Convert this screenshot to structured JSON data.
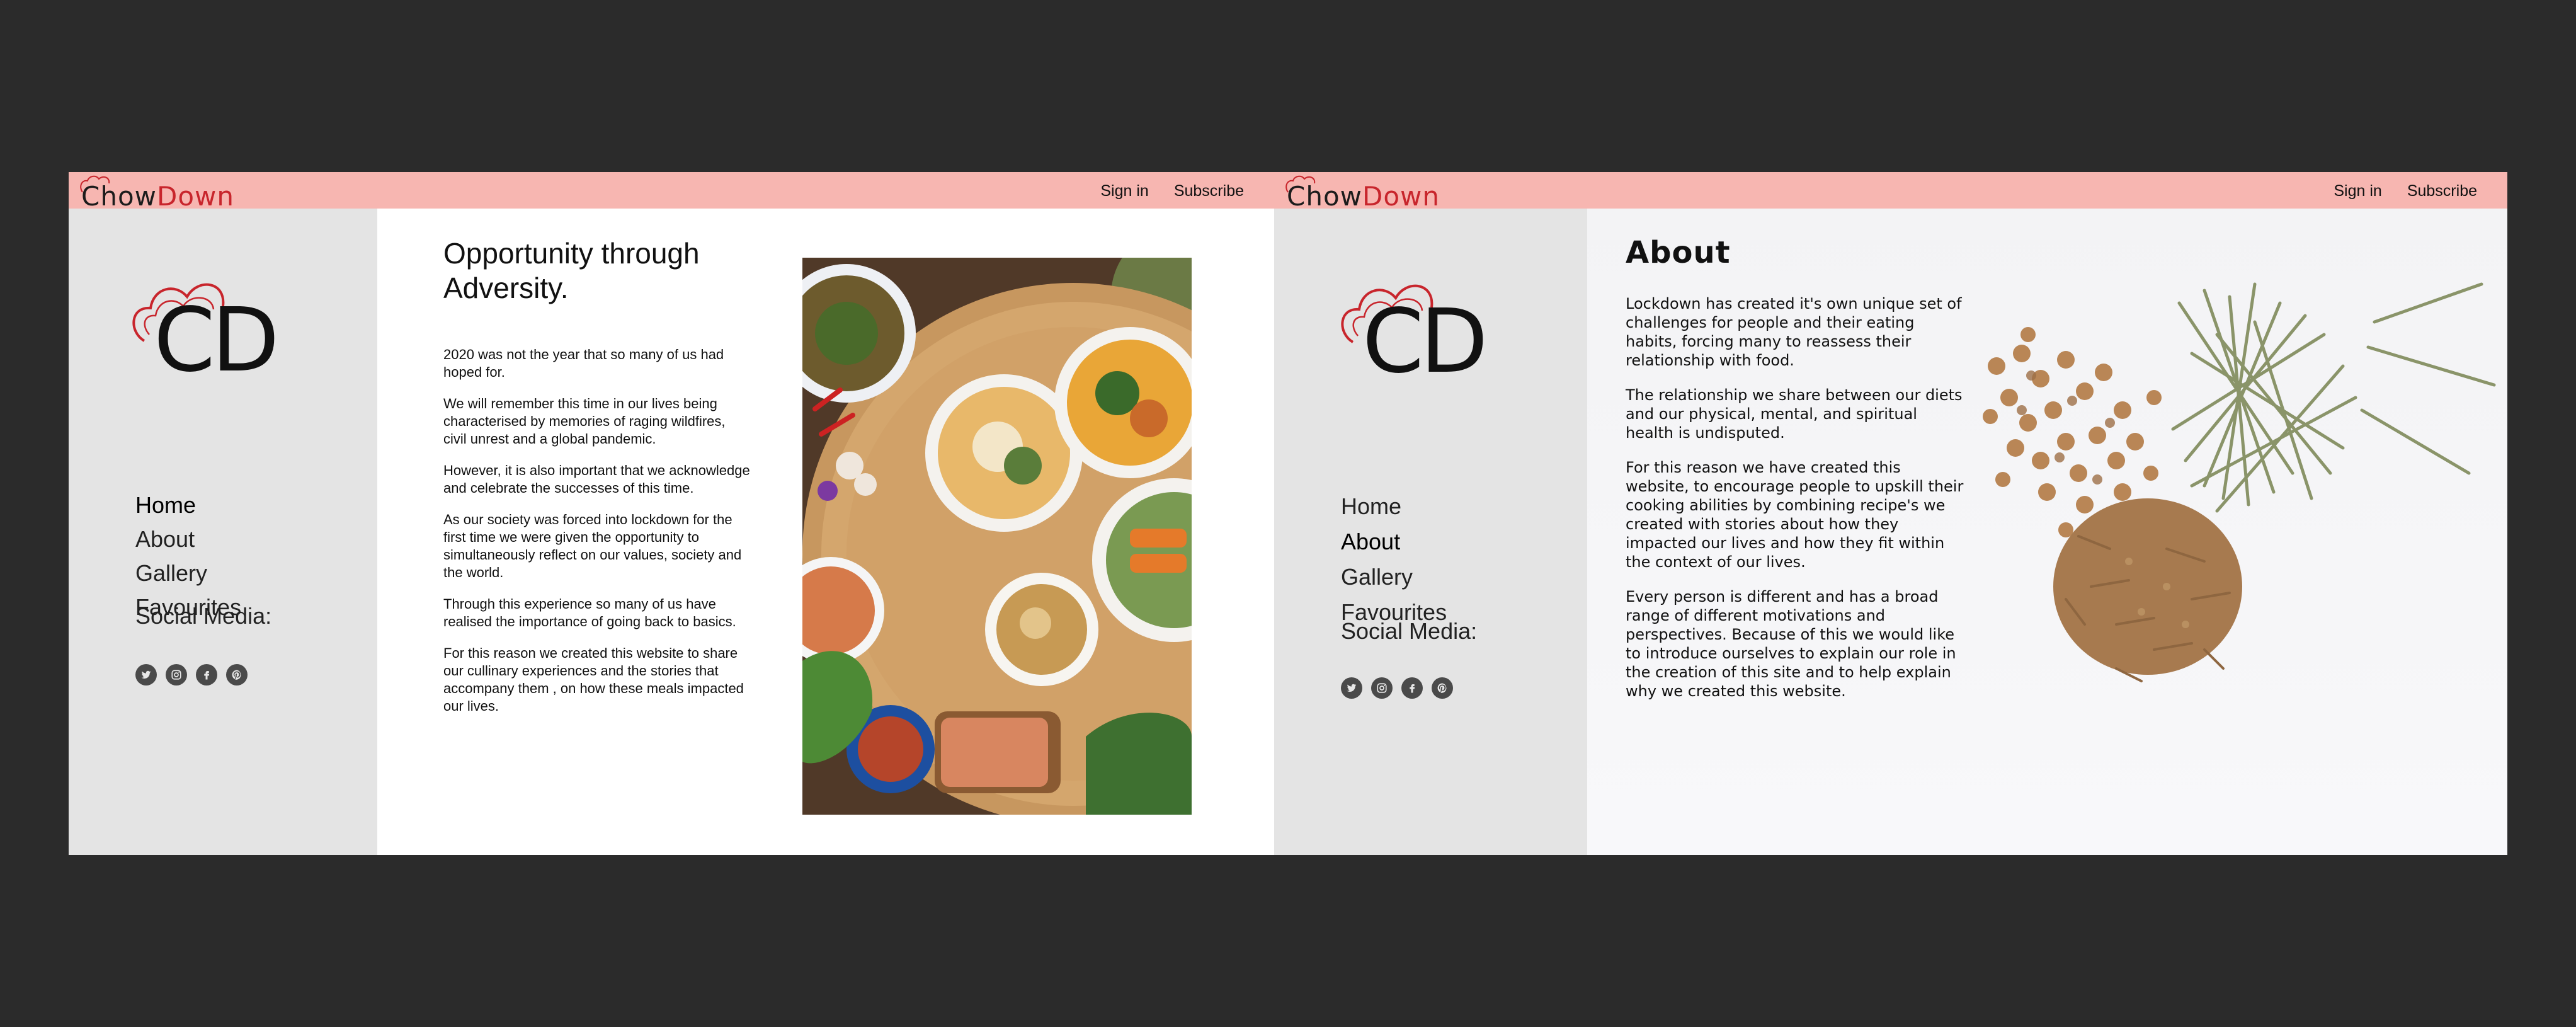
{
  "home": {
    "brand": {
      "part1": "Chow",
      "part2": "Down"
    },
    "top_nav": {
      "sign_in": "Sign in",
      "subscribe": "Subscribe"
    },
    "logo_text": "CD",
    "side_nav": [
      "Home",
      "About",
      "Gallery",
      "Favourites"
    ],
    "social_title": "Social Media:",
    "social_icons": [
      "twitter-icon",
      "instagram-icon",
      "facebook-icon",
      "pinterest-icon"
    ],
    "article": {
      "title": "Opportunity through Adversity.",
      "paragraphs": [
        "2020 was not the year that so many of us had hoped for.",
        "We will remember this time in our lives being characterised by memories of raging wildfires, civil unrest and a global pandemic.",
        "However, it is also important that we acknowledge and celebrate the successes of this time.",
        "As our society was forced into lockdown for the first time we were given the opportunity to simultaneously reflect on our values, society and the world.",
        "Through this experience so many of us have realised the importance of going back to basics.",
        "For this reason we created this website to share our cullinary experiences and the stories that accompany them , on how these meals impacted our lives."
      ]
    }
  },
  "about": {
    "brand": {
      "part1": "Chow",
      "part2": "Down"
    },
    "top_nav": {
      "sign_in": "Sign in",
      "subscribe": "Subscribe"
    },
    "logo_text": "CD",
    "side_nav": [
      "Home",
      "About",
      "Gallery",
      "Favourites"
    ],
    "social_title": "Social Media:",
    "social_icons": [
      "twitter-icon",
      "instagram-icon",
      "facebook-icon",
      "pinterest-icon"
    ],
    "title": "About",
    "paragraphs": [
      "Lockdown has created it's own unique set of challenges for people and their eating habits, forcing many to reassess their relationship with food.",
      "The relationship we share between our diets and our physical, mental, and spiritual health is undisputed.",
      "For this reason we have created this website, to encourage people to upskill their cooking abilities by combining recipe's we created with stories about how they impacted our lives and how they fit within the context of our lives.",
      "Every person is different and has a broad range of different motivations and perspectives. Because of this we would like to introduce ourselves to explain our role in the creation of this site and to help explain why we created this website."
    ]
  },
  "colors": {
    "background": "#2b2b2b",
    "header_pink": "#f7b6b1",
    "sidebar_gray": "#e4e4e4",
    "brand_red": "#c8252c"
  }
}
